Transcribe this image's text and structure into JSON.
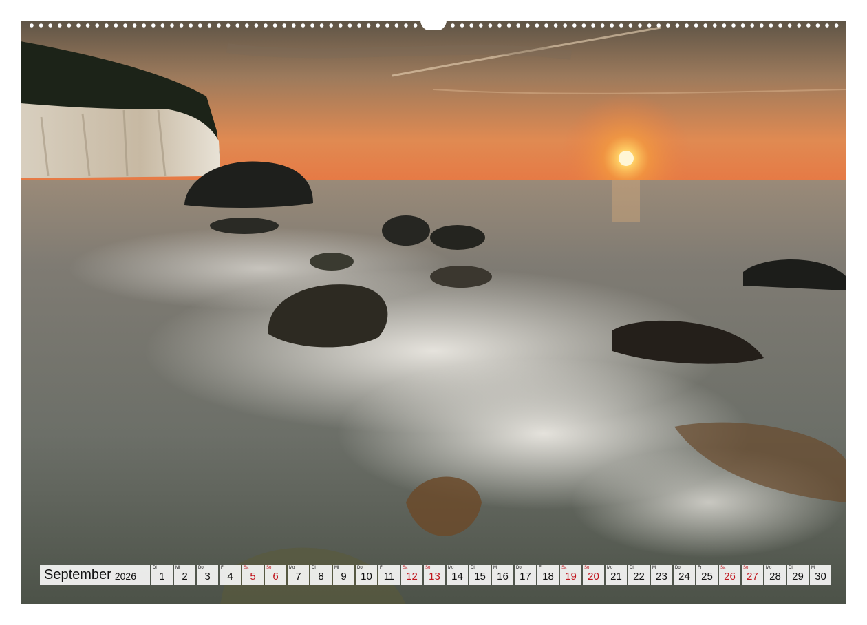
{
  "calendar": {
    "month": "September",
    "year": "2026",
    "weekend_color": "#c0151d",
    "days": [
      {
        "wd": "Di",
        "day": "1",
        "weekend": false
      },
      {
        "wd": "Mi",
        "day": "2",
        "weekend": false
      },
      {
        "wd": "Do",
        "day": "3",
        "weekend": false
      },
      {
        "wd": "Fr",
        "day": "4",
        "weekend": false
      },
      {
        "wd": "Sa",
        "day": "5",
        "weekend": true
      },
      {
        "wd": "So",
        "day": "6",
        "weekend": true
      },
      {
        "wd": "Mo",
        "day": "7",
        "weekend": false
      },
      {
        "wd": "Di",
        "day": "8",
        "weekend": false
      },
      {
        "wd": "Mi",
        "day": "9",
        "weekend": false
      },
      {
        "wd": "Do",
        "day": "10",
        "weekend": false
      },
      {
        "wd": "Fr",
        "day": "11",
        "weekend": false
      },
      {
        "wd": "Sa",
        "day": "12",
        "weekend": true
      },
      {
        "wd": "So",
        "day": "13",
        "weekend": true
      },
      {
        "wd": "Mo",
        "day": "14",
        "weekend": false
      },
      {
        "wd": "Di",
        "day": "15",
        "weekend": false
      },
      {
        "wd": "Mi",
        "day": "16",
        "weekend": false
      },
      {
        "wd": "Do",
        "day": "17",
        "weekend": false
      },
      {
        "wd": "Fr",
        "day": "18",
        "weekend": false
      },
      {
        "wd": "Sa",
        "day": "19",
        "weekend": true
      },
      {
        "wd": "So",
        "day": "20",
        "weekend": true
      },
      {
        "wd": "Mo",
        "day": "21",
        "weekend": false
      },
      {
        "wd": "Di",
        "day": "22",
        "weekend": false
      },
      {
        "wd": "Mi",
        "day": "23",
        "weekend": false
      },
      {
        "wd": "Do",
        "day": "24",
        "weekend": false
      },
      {
        "wd": "Fr",
        "day": "25",
        "weekend": false
      },
      {
        "wd": "Sa",
        "day": "26",
        "weekend": true
      },
      {
        "wd": "So",
        "day": "27",
        "weekend": true
      },
      {
        "wd": "Mo",
        "day": "28",
        "weekend": false
      },
      {
        "wd": "Di",
        "day": "29",
        "weekend": false
      },
      {
        "wd": "Mi",
        "day": "30",
        "weekend": false
      }
    ]
  },
  "photo": {
    "subject": "chalk-cliff-sunset-seascape",
    "sky_color": "#d98a4e",
    "sun_color": "#ffd27a",
    "sea_color": "#8a8478"
  }
}
